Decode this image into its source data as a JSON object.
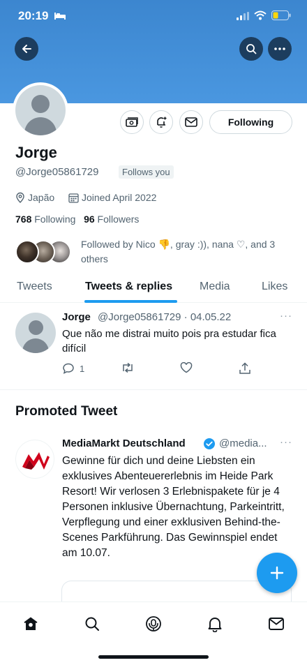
{
  "status_bar": {
    "time": "20:19"
  },
  "profile": {
    "name": "Jorge",
    "handle": "@Jorge05861729",
    "follows_you": "Follows you",
    "location": "Japão",
    "joined": "Joined April 2022",
    "following_count": "768",
    "following_label": "Following",
    "followers_count": "96",
    "followers_label": "Followers",
    "followed_by": "Followed by Nico 👎, gray :)), nana ♡, and 3 others",
    "follow_button": "Following"
  },
  "tabs": [
    {
      "label": "Tweets"
    },
    {
      "label": "Tweets & replies",
      "active": true
    },
    {
      "label": "Media"
    },
    {
      "label": "Likes"
    }
  ],
  "tweet": {
    "name": "Jorge",
    "handle_date": "@Jorge05861729 · 04.05.22",
    "text": "Que não me distrai muito pois pra estudar fica difícil",
    "reply_count": "1"
  },
  "promoted": {
    "section_title": "Promoted Tweet",
    "name": "MediaMarkt Deutschland",
    "handle": "@media...",
    "text": "Gewinne für dich und deine Liebsten ein exklusives Abenteuererlebnis im Heide Park Resort! Wir verlosen 3 Erlebnispakete für je 4 Personen inklusive Übernachtung, Parkeintritt, Verpflegung und einer exklusiven Behind-the-Scenes Parkführung. Das Gewinnspiel endet am 10.07."
  },
  "colors": {
    "accent": "#1d9bf0",
    "banner": "#4a97e0",
    "secondary_text": "#536471"
  }
}
